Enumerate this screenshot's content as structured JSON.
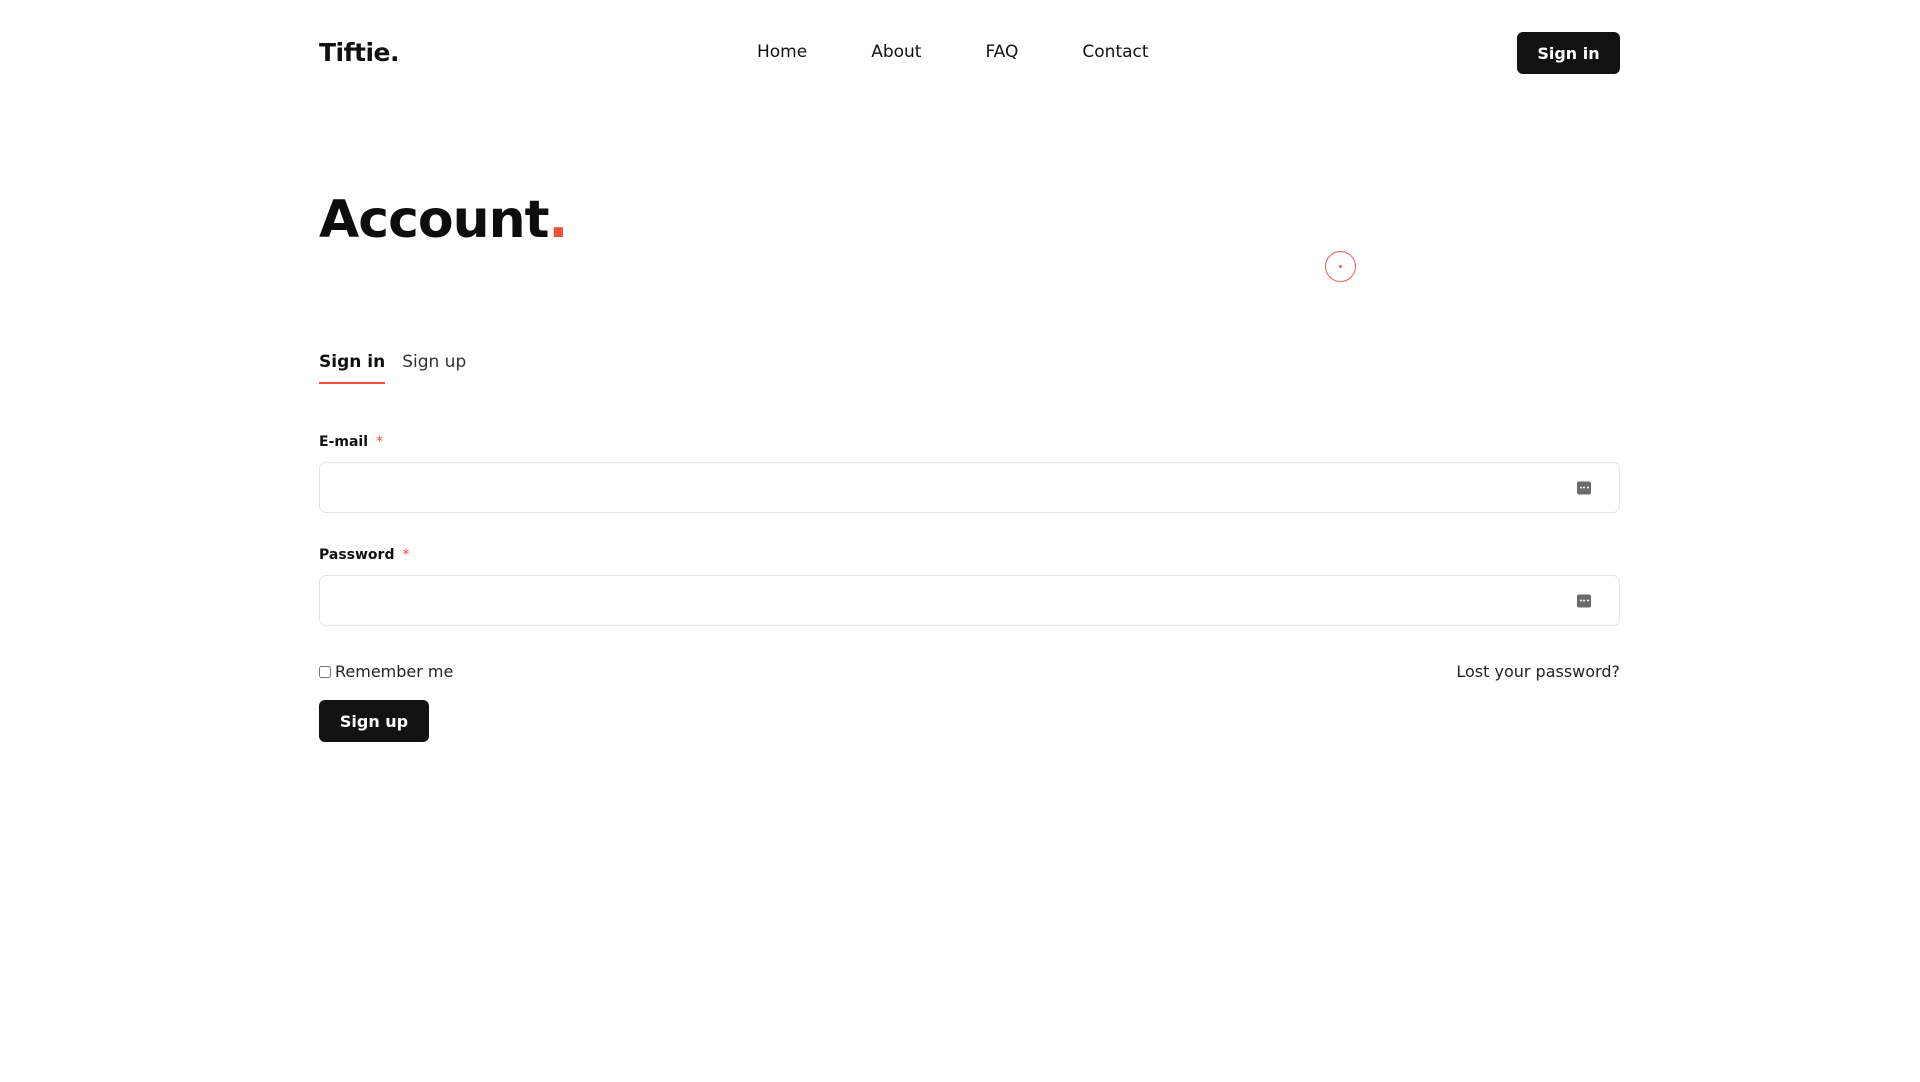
{
  "header": {
    "logo": "Tiftie.",
    "nav": [
      "Home",
      "About",
      "FAQ",
      "Contact"
    ],
    "signin_label": "Sign in"
  },
  "page": {
    "title": "Account",
    "title_dot": ".",
    "accent_color": "#f04e37"
  },
  "tabs": {
    "signin": "Sign in",
    "signup": "Sign up",
    "active": "Sign in"
  },
  "form": {
    "email_label": "E-mail",
    "email_required": "*",
    "email_value": "",
    "password_label": "Password",
    "password_required": "*",
    "password_value": "",
    "autofill_icon": "autofill-key-icon",
    "remember_label": "Remember me",
    "remember_checked": false,
    "lost_password": "Lost your password?",
    "submit_label": "Sign up"
  }
}
